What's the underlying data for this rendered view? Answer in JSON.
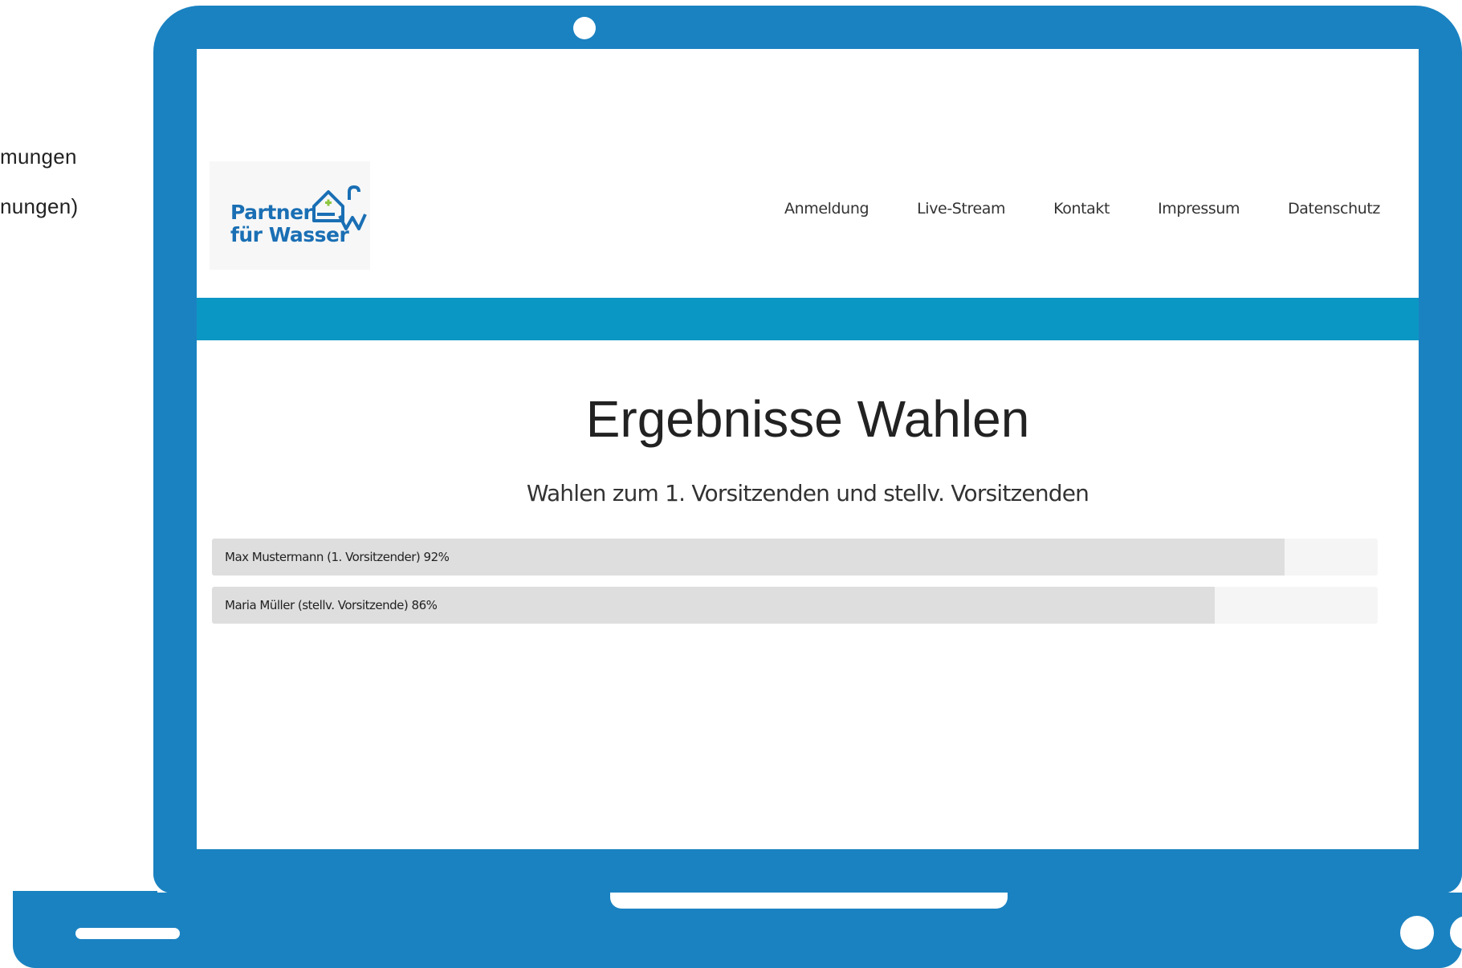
{
  "side_text": {
    "line1": "mungen",
    "line2": "nungen)"
  },
  "colors": {
    "laptop": "#1a82c1",
    "accent_band": "#0b97c4",
    "bar_fill": "#dedede",
    "bar_track": "#f5f5f5",
    "logo_blue": "#1a6fb4",
    "logo_green": "#8dc63f"
  },
  "site": {
    "logo": {
      "line1": "Partner",
      "line2": "für Wasser"
    },
    "nav": [
      {
        "label": "Anmeldung"
      },
      {
        "label": "Live-Stream"
      },
      {
        "label": "Kontakt"
      },
      {
        "label": "Impressum"
      },
      {
        "label": "Datenschutz"
      }
    ]
  },
  "main": {
    "title": "Ergebnisse Wahlen",
    "subtitle": "Wahlen zum 1. Vorsitzenden und stellv. Vorsitzenden",
    "results": [
      {
        "label": "Max Mustermann (1. Vorsitzender) 92%",
        "percent": 92
      },
      {
        "label": "Maria Müller (stellv. Vorsitzende) 86%",
        "percent": 86
      }
    ]
  }
}
